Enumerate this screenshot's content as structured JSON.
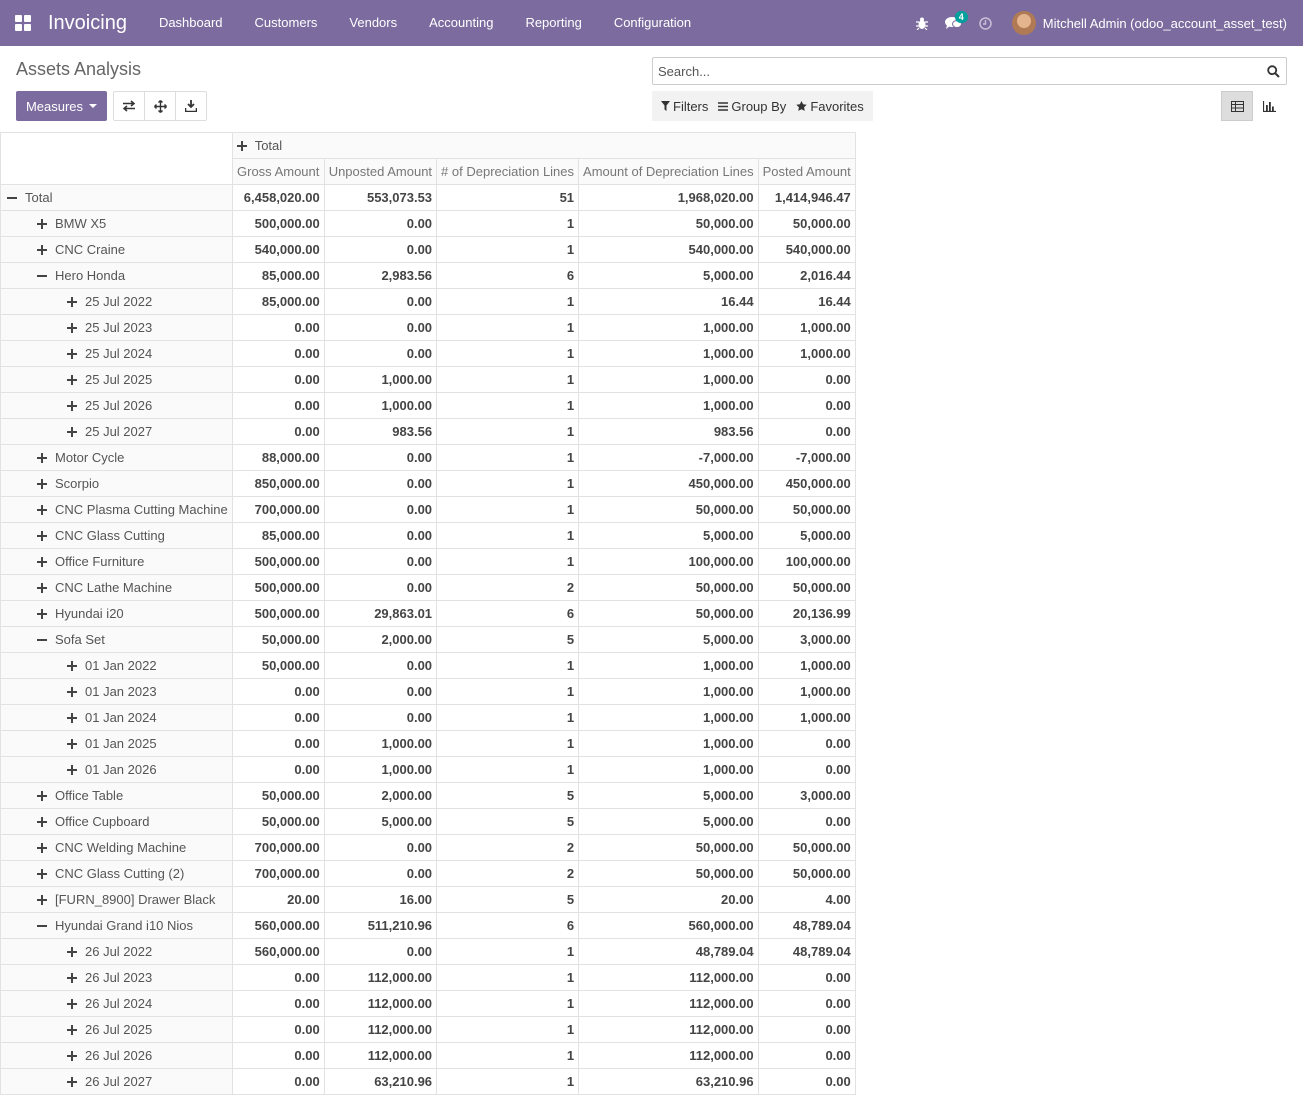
{
  "navbar": {
    "app_name": "Invoicing",
    "menu": [
      "Dashboard",
      "Customers",
      "Vendors",
      "Accounting",
      "Reporting",
      "Configuration"
    ],
    "messages_count": "4",
    "user_name": "Mitchell Admin (odoo_account_asset_test)",
    "bg_color": "#7c6b9e"
  },
  "control_panel": {
    "title": "Assets Analysis",
    "search_placeholder": "Search...",
    "measures_label": "Measures",
    "filters_label": "Filters",
    "group_by_label": "Group By",
    "favorites_label": "Favorites",
    "icons": [
      "flip-axis-icon",
      "expand-all-icon",
      "download-icon",
      "search-icon",
      "pivot-view-icon",
      "graph-view-icon"
    ]
  },
  "pivot": {
    "column_header": "Total",
    "measures": [
      "Gross Amount",
      "Unposted Amount",
      "# of Depreciation Lines",
      "Amount of Depreciation Lines",
      "Posted Amount"
    ],
    "rows": [
      {
        "label": "Total",
        "level": 0,
        "toggle": "minus",
        "values": [
          "6,458,020.00",
          "553,073.53",
          "51",
          "1,968,020.00",
          "1,414,946.47"
        ]
      },
      {
        "label": "BMW X5",
        "level": 1,
        "toggle": "plus",
        "values": [
          "500,000.00",
          "0.00",
          "1",
          "50,000.00",
          "50,000.00"
        ]
      },
      {
        "label": "CNC Craine",
        "level": 1,
        "toggle": "plus",
        "values": [
          "540,000.00",
          "0.00",
          "1",
          "540,000.00",
          "540,000.00"
        ]
      },
      {
        "label": "Hero Honda",
        "level": 1,
        "toggle": "minus",
        "values": [
          "85,000.00",
          "2,983.56",
          "6",
          "5,000.00",
          "2,016.44"
        ]
      },
      {
        "label": "25 Jul 2022",
        "level": 2,
        "toggle": "plus",
        "values": [
          "85,000.00",
          "0.00",
          "1",
          "16.44",
          "16.44"
        ]
      },
      {
        "label": "25 Jul 2023",
        "level": 2,
        "toggle": "plus",
        "values": [
          "0.00",
          "0.00",
          "1",
          "1,000.00",
          "1,000.00"
        ]
      },
      {
        "label": "25 Jul 2024",
        "level": 2,
        "toggle": "plus",
        "values": [
          "0.00",
          "0.00",
          "1",
          "1,000.00",
          "1,000.00"
        ]
      },
      {
        "label": "25 Jul 2025",
        "level": 2,
        "toggle": "plus",
        "values": [
          "0.00",
          "1,000.00",
          "1",
          "1,000.00",
          "0.00"
        ]
      },
      {
        "label": "25 Jul 2026",
        "level": 2,
        "toggle": "plus",
        "values": [
          "0.00",
          "1,000.00",
          "1",
          "1,000.00",
          "0.00"
        ]
      },
      {
        "label": "25 Jul 2027",
        "level": 2,
        "toggle": "plus",
        "values": [
          "0.00",
          "983.56",
          "1",
          "983.56",
          "0.00"
        ]
      },
      {
        "label": "Motor Cycle",
        "level": 1,
        "toggle": "plus",
        "values": [
          "88,000.00",
          "0.00",
          "1",
          "-7,000.00",
          "-7,000.00"
        ]
      },
      {
        "label": "Scorpio",
        "level": 1,
        "toggle": "plus",
        "values": [
          "850,000.00",
          "0.00",
          "1",
          "450,000.00",
          "450,000.00"
        ]
      },
      {
        "label": "CNC Plasma Cutting Machine",
        "level": 1,
        "toggle": "plus",
        "values": [
          "700,000.00",
          "0.00",
          "1",
          "50,000.00",
          "50,000.00"
        ]
      },
      {
        "label": "CNC Glass Cutting",
        "level": 1,
        "toggle": "plus",
        "values": [
          "85,000.00",
          "0.00",
          "1",
          "5,000.00",
          "5,000.00"
        ]
      },
      {
        "label": "Office Furniture",
        "level": 1,
        "toggle": "plus",
        "values": [
          "500,000.00",
          "0.00",
          "1",
          "100,000.00",
          "100,000.00"
        ]
      },
      {
        "label": "CNC Lathe Machine",
        "level": 1,
        "toggle": "plus",
        "values": [
          "500,000.00",
          "0.00",
          "2",
          "50,000.00",
          "50,000.00"
        ]
      },
      {
        "label": "Hyundai i20",
        "level": 1,
        "toggle": "plus",
        "values": [
          "500,000.00",
          "29,863.01",
          "6",
          "50,000.00",
          "20,136.99"
        ]
      },
      {
        "label": "Sofa Set",
        "level": 1,
        "toggle": "minus",
        "values": [
          "50,000.00",
          "2,000.00",
          "5",
          "5,000.00",
          "3,000.00"
        ]
      },
      {
        "label": "01 Jan 2022",
        "level": 2,
        "toggle": "plus",
        "values": [
          "50,000.00",
          "0.00",
          "1",
          "1,000.00",
          "1,000.00"
        ]
      },
      {
        "label": "01 Jan 2023",
        "level": 2,
        "toggle": "plus",
        "values": [
          "0.00",
          "0.00",
          "1",
          "1,000.00",
          "1,000.00"
        ]
      },
      {
        "label": "01 Jan 2024",
        "level": 2,
        "toggle": "plus",
        "values": [
          "0.00",
          "0.00",
          "1",
          "1,000.00",
          "1,000.00"
        ]
      },
      {
        "label": "01 Jan 2025",
        "level": 2,
        "toggle": "plus",
        "values": [
          "0.00",
          "1,000.00",
          "1",
          "1,000.00",
          "0.00"
        ]
      },
      {
        "label": "01 Jan 2026",
        "level": 2,
        "toggle": "plus",
        "values": [
          "0.00",
          "1,000.00",
          "1",
          "1,000.00",
          "0.00"
        ]
      },
      {
        "label": "Office Table",
        "level": 1,
        "toggle": "plus",
        "values": [
          "50,000.00",
          "2,000.00",
          "5",
          "5,000.00",
          "3,000.00"
        ]
      },
      {
        "label": "Office Cupboard",
        "level": 1,
        "toggle": "plus",
        "values": [
          "50,000.00",
          "5,000.00",
          "5",
          "5,000.00",
          "0.00"
        ]
      },
      {
        "label": "CNC Welding Machine",
        "level": 1,
        "toggle": "plus",
        "values": [
          "700,000.00",
          "0.00",
          "2",
          "50,000.00",
          "50,000.00"
        ]
      },
      {
        "label": "CNC Glass Cutting (2)",
        "level": 1,
        "toggle": "plus",
        "values": [
          "700,000.00",
          "0.00",
          "2",
          "50,000.00",
          "50,000.00"
        ]
      },
      {
        "label": "[FURN_8900] Drawer Black",
        "level": 1,
        "toggle": "plus",
        "values": [
          "20.00",
          "16.00",
          "5",
          "20.00",
          "4.00"
        ]
      },
      {
        "label": "Hyundai Grand i10 Nios",
        "level": 1,
        "toggle": "minus",
        "values": [
          "560,000.00",
          "511,210.96",
          "6",
          "560,000.00",
          "48,789.04"
        ]
      },
      {
        "label": "26 Jul 2022",
        "level": 2,
        "toggle": "plus",
        "values": [
          "560,000.00",
          "0.00",
          "1",
          "48,789.04",
          "48,789.04"
        ]
      },
      {
        "label": "26 Jul 2023",
        "level": 2,
        "toggle": "plus",
        "values": [
          "0.00",
          "112,000.00",
          "1",
          "112,000.00",
          "0.00"
        ]
      },
      {
        "label": "26 Jul 2024",
        "level": 2,
        "toggle": "plus",
        "values": [
          "0.00",
          "112,000.00",
          "1",
          "112,000.00",
          "0.00"
        ]
      },
      {
        "label": "26 Jul 2025",
        "level": 2,
        "toggle": "plus",
        "values": [
          "0.00",
          "112,000.00",
          "1",
          "112,000.00",
          "0.00"
        ]
      },
      {
        "label": "26 Jul 2026",
        "level": 2,
        "toggle": "plus",
        "values": [
          "0.00",
          "112,000.00",
          "1",
          "112,000.00",
          "0.00"
        ]
      },
      {
        "label": "26 Jul 2027",
        "level": 2,
        "toggle": "plus",
        "values": [
          "0.00",
          "63,210.96",
          "1",
          "63,210.96",
          "0.00"
        ]
      }
    ]
  }
}
